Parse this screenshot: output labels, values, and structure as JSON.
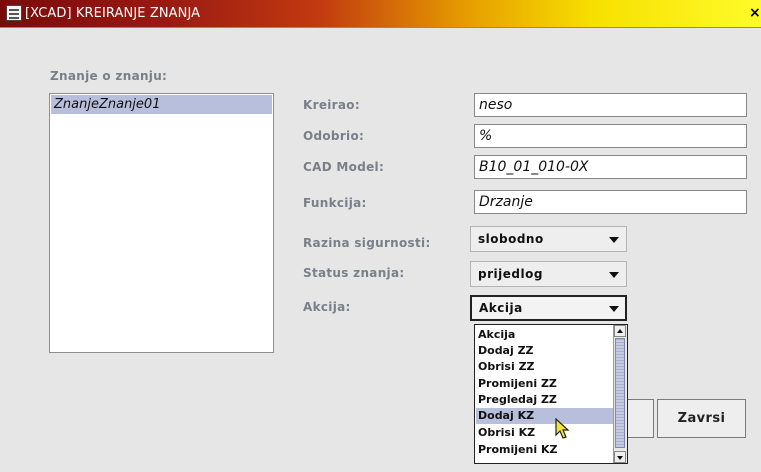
{
  "window": {
    "title": "[XCAD] KREIRANJE ZNANJA",
    "close_glyph": "×"
  },
  "knowledge_list": {
    "label": "Znanje o znanju:",
    "items": [
      "ZnanjeZnanje01"
    ],
    "selected_index": 0
  },
  "form": {
    "kreirao": {
      "label": "Kreirao:",
      "value": "neso"
    },
    "odobrio": {
      "label": "Odobrio:",
      "value": "%"
    },
    "cad_model": {
      "label": "CAD Model:",
      "value": "B10_01_010-0X"
    },
    "funkcija": {
      "label": "Funkcija:",
      "value": "Drzanje"
    },
    "razina": {
      "label": "Razina sigurnosti:",
      "value": "slobodno"
    },
    "status": {
      "label": "Status znanja:",
      "value": "prijedlog"
    },
    "akcija": {
      "label": "Akcija:",
      "value": "Akcija",
      "options": [
        "Akcija",
        "Dodaj ZZ",
        "Obrisi ZZ",
        "Promijeni ZZ",
        "Pregledaj ZZ",
        "Dodaj KZ",
        "Obrisi KZ",
        "Promijeni KZ"
      ],
      "highlighted_index": 5
    }
  },
  "buttons": {
    "zavrsi": "Zavrsi"
  },
  "colors": {
    "selection": "#b8bfdc",
    "label": "#7b7f8a"
  }
}
